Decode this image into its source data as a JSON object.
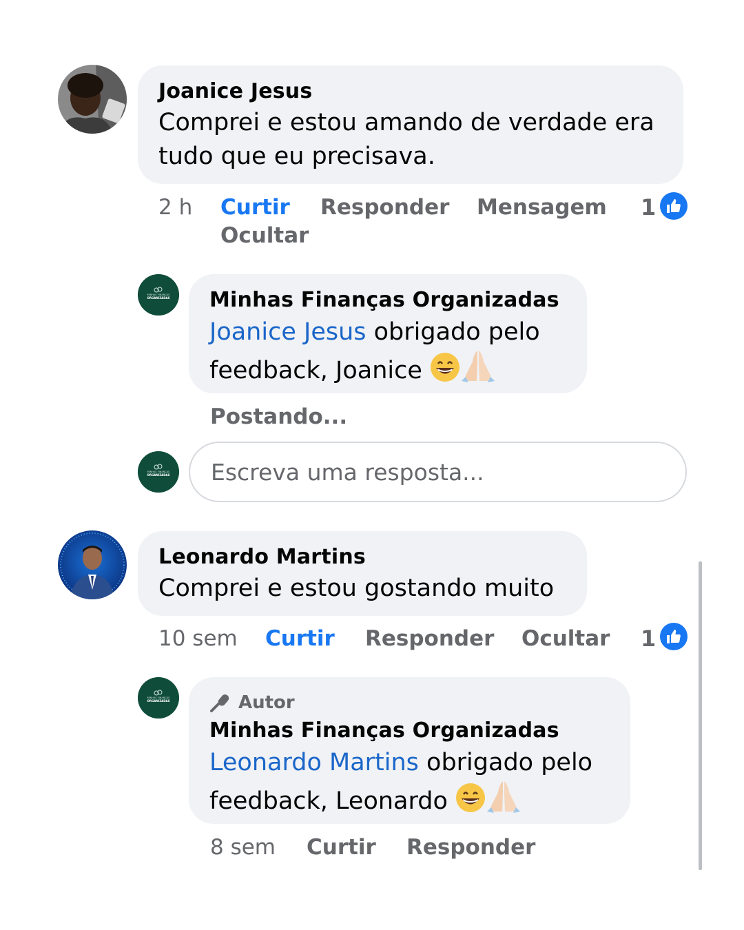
{
  "comments": [
    {
      "author": "Joanice Jesus",
      "text_line1": "Comprei e estou amando de verdade era",
      "text_line2": "tudo que eu precisava.",
      "time": "2 h",
      "actions": {
        "like": "Curtir",
        "reply": "Responder",
        "message": "Mensagem",
        "hide": "Ocultar"
      },
      "like_count": "1",
      "reply": {
        "author": "Minhas Finanças Organizadas",
        "mention": "Joanice Jesus",
        "text_after_mention": " obrigado pelo",
        "text_line2": "feedback, Joanice",
        "emojis": [
          "grinning-face",
          "folded-hands"
        ],
        "status": "Postando..."
      },
      "reply_input": {
        "placeholder": "Escreva uma resposta..."
      }
    },
    {
      "author": "Leonardo Martins",
      "text_line1": "Comprei e estou gostando muito",
      "time": "10 sem",
      "actions": {
        "like": "Curtir",
        "reply": "Responder",
        "hide": "Ocultar"
      },
      "like_count": "1",
      "reply": {
        "badge": "Autor",
        "author": "Minhas Finanças Organizadas",
        "mention": "Leonardo Martins",
        "text_after_mention": " obrigado pelo",
        "text_line2": "feedback, Leonardo",
        "emojis": [
          "grinning-face",
          "folded-hands"
        ],
        "time": "8 sem",
        "actions": {
          "like": "Curtir",
          "reply": "Responder"
        }
      }
    }
  ],
  "page_avatar_text": {
    "line1": "MINHAS FINANÇAS",
    "line2": "ORGANIZADAS"
  },
  "colors": {
    "bubble": "#f0f2f5",
    "link": "#1b66c9",
    "like_blue": "#1877f2",
    "muted": "#65676b",
    "page_green": "#0f4d3a"
  }
}
